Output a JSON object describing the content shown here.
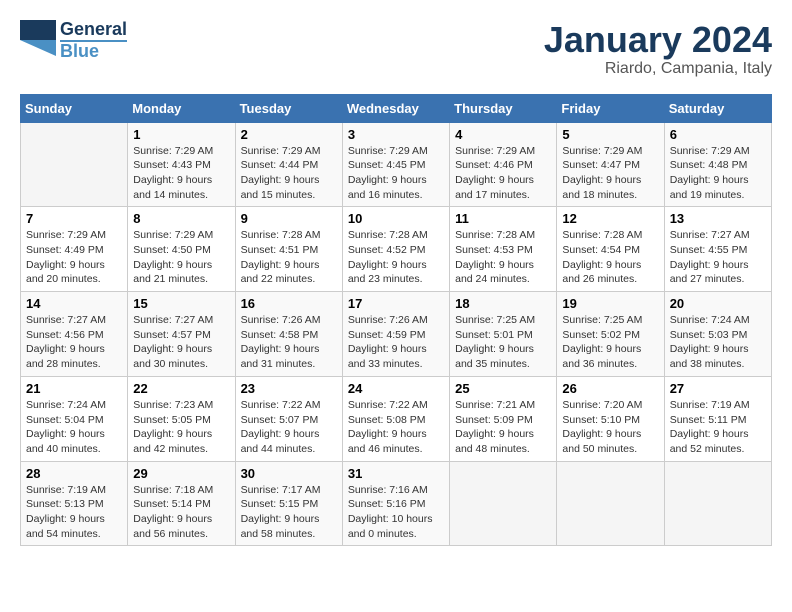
{
  "logo": {
    "text1": "General",
    "text2": "Blue"
  },
  "title": {
    "month": "January 2024",
    "location": "Riardo, Campania, Italy"
  },
  "headers": [
    "Sunday",
    "Monday",
    "Tuesday",
    "Wednesday",
    "Thursday",
    "Friday",
    "Saturday"
  ],
  "weeks": [
    [
      {
        "day": "",
        "sunrise": "",
        "sunset": "",
        "daylight": ""
      },
      {
        "day": "1",
        "sunrise": "7:29 AM",
        "sunset": "4:43 PM",
        "daylight": "9 hours and 14 minutes."
      },
      {
        "day": "2",
        "sunrise": "7:29 AM",
        "sunset": "4:44 PM",
        "daylight": "9 hours and 15 minutes."
      },
      {
        "day": "3",
        "sunrise": "7:29 AM",
        "sunset": "4:45 PM",
        "daylight": "9 hours and 16 minutes."
      },
      {
        "day": "4",
        "sunrise": "7:29 AM",
        "sunset": "4:46 PM",
        "daylight": "9 hours and 17 minutes."
      },
      {
        "day": "5",
        "sunrise": "7:29 AM",
        "sunset": "4:47 PM",
        "daylight": "9 hours and 18 minutes."
      },
      {
        "day": "6",
        "sunrise": "7:29 AM",
        "sunset": "4:48 PM",
        "daylight": "9 hours and 19 minutes."
      }
    ],
    [
      {
        "day": "7",
        "sunrise": "7:29 AM",
        "sunset": "4:49 PM",
        "daylight": "9 hours and 20 minutes."
      },
      {
        "day": "8",
        "sunrise": "7:29 AM",
        "sunset": "4:50 PM",
        "daylight": "9 hours and 21 minutes."
      },
      {
        "day": "9",
        "sunrise": "7:28 AM",
        "sunset": "4:51 PM",
        "daylight": "9 hours and 22 minutes."
      },
      {
        "day": "10",
        "sunrise": "7:28 AM",
        "sunset": "4:52 PM",
        "daylight": "9 hours and 23 minutes."
      },
      {
        "day": "11",
        "sunrise": "7:28 AM",
        "sunset": "4:53 PM",
        "daylight": "9 hours and 24 minutes."
      },
      {
        "day": "12",
        "sunrise": "7:28 AM",
        "sunset": "4:54 PM",
        "daylight": "9 hours and 26 minutes."
      },
      {
        "day": "13",
        "sunrise": "7:27 AM",
        "sunset": "4:55 PM",
        "daylight": "9 hours and 27 minutes."
      }
    ],
    [
      {
        "day": "14",
        "sunrise": "7:27 AM",
        "sunset": "4:56 PM",
        "daylight": "9 hours and 28 minutes."
      },
      {
        "day": "15",
        "sunrise": "7:27 AM",
        "sunset": "4:57 PM",
        "daylight": "9 hours and 30 minutes."
      },
      {
        "day": "16",
        "sunrise": "7:26 AM",
        "sunset": "4:58 PM",
        "daylight": "9 hours and 31 minutes."
      },
      {
        "day": "17",
        "sunrise": "7:26 AM",
        "sunset": "4:59 PM",
        "daylight": "9 hours and 33 minutes."
      },
      {
        "day": "18",
        "sunrise": "7:25 AM",
        "sunset": "5:01 PM",
        "daylight": "9 hours and 35 minutes."
      },
      {
        "day": "19",
        "sunrise": "7:25 AM",
        "sunset": "5:02 PM",
        "daylight": "9 hours and 36 minutes."
      },
      {
        "day": "20",
        "sunrise": "7:24 AM",
        "sunset": "5:03 PM",
        "daylight": "9 hours and 38 minutes."
      }
    ],
    [
      {
        "day": "21",
        "sunrise": "7:24 AM",
        "sunset": "5:04 PM",
        "daylight": "9 hours and 40 minutes."
      },
      {
        "day": "22",
        "sunrise": "7:23 AM",
        "sunset": "5:05 PM",
        "daylight": "9 hours and 42 minutes."
      },
      {
        "day": "23",
        "sunrise": "7:22 AM",
        "sunset": "5:07 PM",
        "daylight": "9 hours and 44 minutes."
      },
      {
        "day": "24",
        "sunrise": "7:22 AM",
        "sunset": "5:08 PM",
        "daylight": "9 hours and 46 minutes."
      },
      {
        "day": "25",
        "sunrise": "7:21 AM",
        "sunset": "5:09 PM",
        "daylight": "9 hours and 48 minutes."
      },
      {
        "day": "26",
        "sunrise": "7:20 AM",
        "sunset": "5:10 PM",
        "daylight": "9 hours and 50 minutes."
      },
      {
        "day": "27",
        "sunrise": "7:19 AM",
        "sunset": "5:11 PM",
        "daylight": "9 hours and 52 minutes."
      }
    ],
    [
      {
        "day": "28",
        "sunrise": "7:19 AM",
        "sunset": "5:13 PM",
        "daylight": "9 hours and 54 minutes."
      },
      {
        "day": "29",
        "sunrise": "7:18 AM",
        "sunset": "5:14 PM",
        "daylight": "9 hours and 56 minutes."
      },
      {
        "day": "30",
        "sunrise": "7:17 AM",
        "sunset": "5:15 PM",
        "daylight": "9 hours and 58 minutes."
      },
      {
        "day": "31",
        "sunrise": "7:16 AM",
        "sunset": "5:16 PM",
        "daylight": "10 hours and 0 minutes."
      },
      {
        "day": "",
        "sunrise": "",
        "sunset": "",
        "daylight": ""
      },
      {
        "day": "",
        "sunrise": "",
        "sunset": "",
        "daylight": ""
      },
      {
        "day": "",
        "sunrise": "",
        "sunset": "",
        "daylight": ""
      }
    ]
  ],
  "labels": {
    "sunrise_prefix": "Sunrise: ",
    "sunset_prefix": "Sunset: ",
    "daylight_prefix": "Daylight: "
  }
}
